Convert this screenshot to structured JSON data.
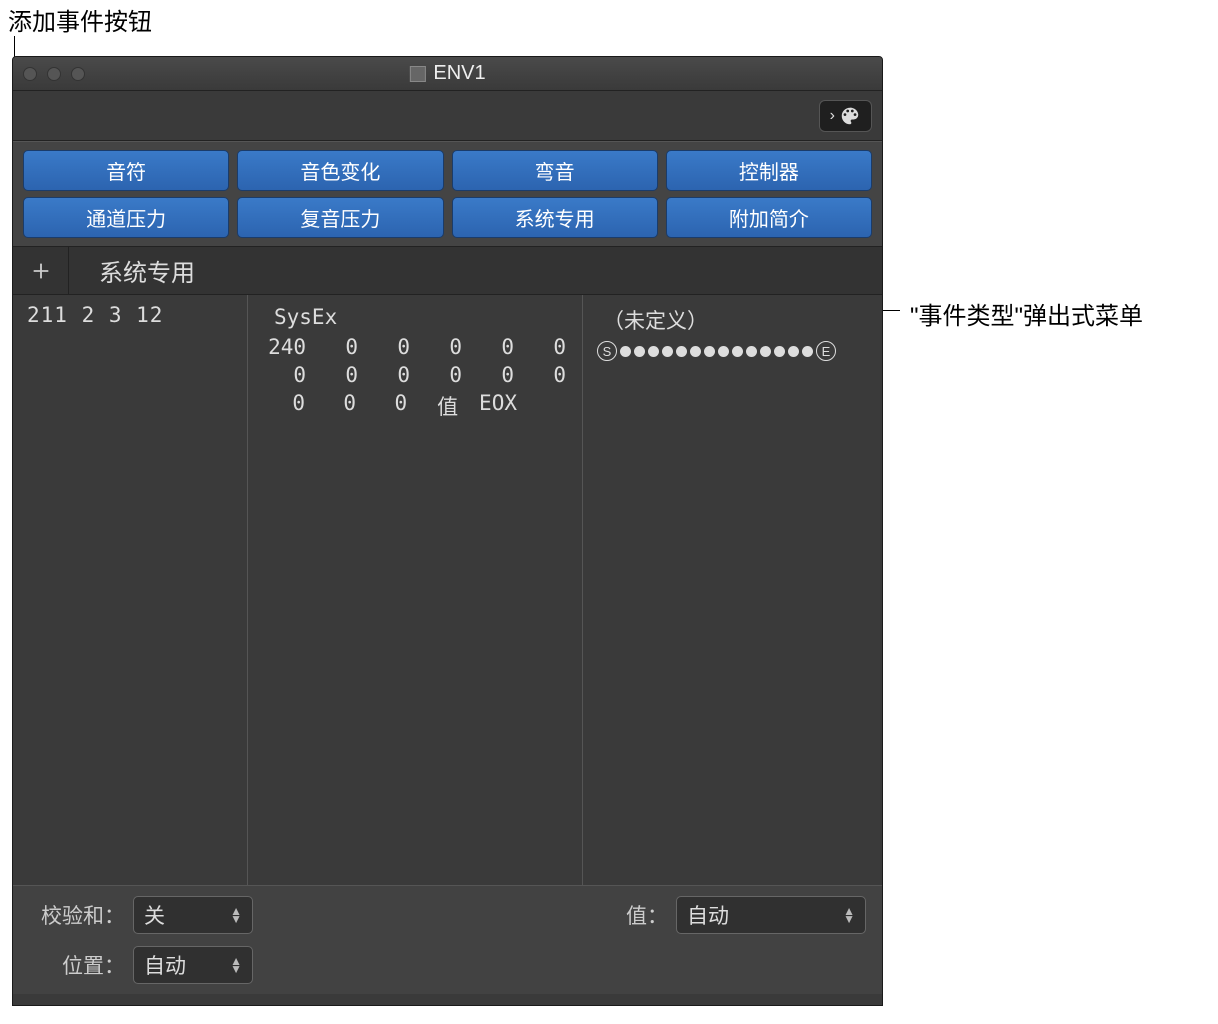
{
  "callouts": {
    "top": "添加事件按钮",
    "right": "\"事件类型\"弹出式菜单"
  },
  "window": {
    "title": "ENV1"
  },
  "filters": {
    "row1": [
      "音符",
      "音色变化",
      "弯音",
      "控制器"
    ],
    "row2": [
      "通道压力",
      "复音压力",
      "系统专用",
      "附加简介"
    ]
  },
  "event_header": {
    "type_label": "系统专用"
  },
  "columns": {
    "position": "211 2 3   12",
    "sysex_title": "SysEx",
    "col3_title": "（未定义）",
    "dot_start": "S",
    "dot_end": "E"
  },
  "sysex_data": {
    "rows": [
      [
        "240",
        "0",
        "0",
        "0",
        "0",
        "0"
      ],
      [
        "0",
        "0",
        "0",
        "0",
        "0",
        "0"
      ],
      [
        "0",
        "0",
        "0",
        "值",
        "EOX",
        ""
      ]
    ]
  },
  "bottom": {
    "checksum_label": "校验和：",
    "checksum_value": "关",
    "value_label": "值：",
    "value_value": "自动",
    "position_label": "位置：",
    "position_value": "自动"
  }
}
